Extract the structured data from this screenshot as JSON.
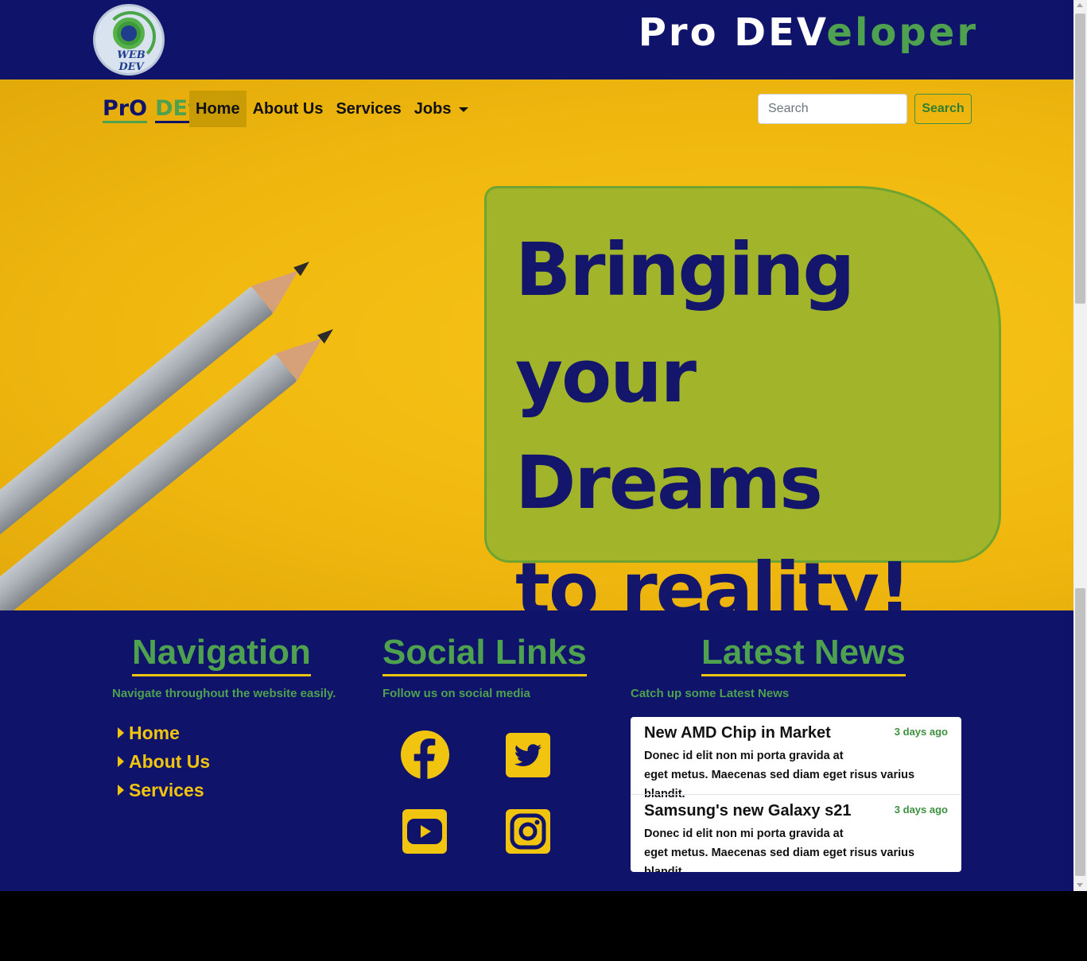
{
  "header": {
    "logo_text": "WEB DEV",
    "brand_part1": "Pro DEV",
    "brand_part2": "eloper"
  },
  "navbar": {
    "brand_part1": "PrO",
    "brand_part2": "DEv",
    "items": [
      {
        "label": "Home",
        "active": true
      },
      {
        "label": "About Us"
      },
      {
        "label": "Services"
      },
      {
        "label": "Jobs"
      }
    ],
    "search_placeholder": "Search",
    "search_button": "Search"
  },
  "hero": {
    "tagline_line1": "Bringing",
    "tagline_line2": "your Dreams",
    "tagline_line3": "to reality!"
  },
  "footer": {
    "navigation": {
      "title": "Navigation",
      "subtitle": "Navigate throughout the website easily.",
      "links": [
        "Home",
        "About Us",
        "Services"
      ]
    },
    "social": {
      "title": "Social Links",
      "subtitle": "Follow us on social media",
      "icons": [
        "facebook-icon",
        "twitter-icon",
        "youtube-icon",
        "instagram-icon"
      ]
    },
    "news": {
      "title": "Latest News",
      "subtitle": "Catch up some Latest News",
      "items": [
        {
          "title": "New AMD Chip in Market",
          "time": "3 days ago",
          "body": "Donec id elit non mi porta gravida at\neget metus. Maecenas sed diam eget risus varius blandit."
        },
        {
          "title": "Samsung's new Galaxy s21",
          "time": "3 days ago",
          "body": "Donec id elit non mi porta gravida at\neget metus. Maecenas sed diam eget risus varius blandit."
        }
      ]
    }
  },
  "colors": {
    "navy": "#10136a",
    "green": "#4ea14f",
    "yellow": "#f1c40f",
    "hero_yellow": "#f1b90f",
    "tagline_box": "#a2b42a"
  }
}
